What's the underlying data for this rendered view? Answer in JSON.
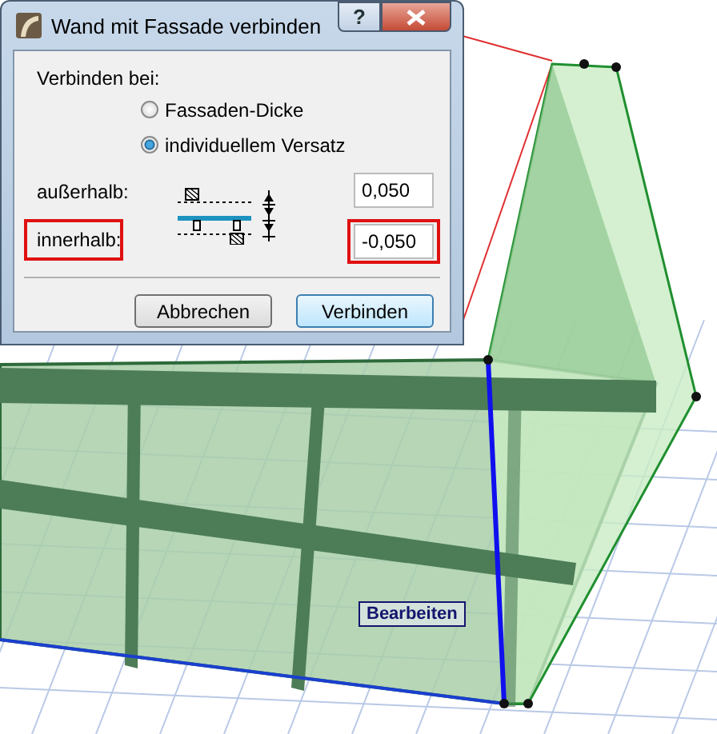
{
  "dialog": {
    "title": "Wand mit Fassade verbinden",
    "help_button": "?",
    "group_label": "Verbinden bei:",
    "options": [
      {
        "label": "Fassaden-Dicke",
        "selected": false
      },
      {
        "label": "individuellem Versatz",
        "selected": true
      }
    ],
    "fields": [
      {
        "label": "außerhalb:",
        "value": "0,050",
        "highlighted": false
      },
      {
        "label": "innerhalb:",
        "value": "-0,050",
        "highlighted": true
      }
    ],
    "buttons": [
      {
        "label": "Abbrechen",
        "default": false
      },
      {
        "label": "Verbinden",
        "default": true
      }
    ]
  },
  "canvas": {
    "tag": "Bearbeiten"
  }
}
